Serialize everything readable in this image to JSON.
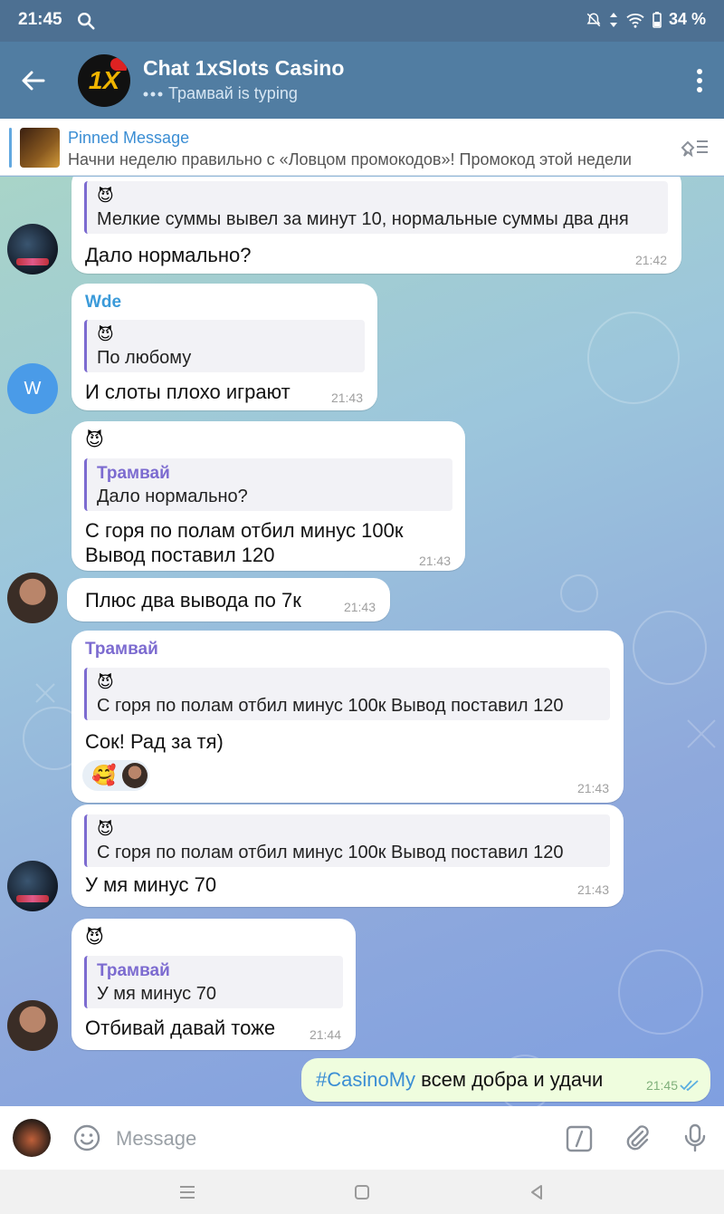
{
  "status": {
    "time": "21:45",
    "battery": "34 %"
  },
  "header": {
    "title": "Chat 1xSlots Casino",
    "subtitle": "Трамвай is typing",
    "avatar_label": "1X"
  },
  "pinned": {
    "title": "Pinned Message",
    "text": "Начни неделю правильно с «Ловцом промокодов»!   Промокод этой недели"
  },
  "messages": [
    {
      "reply_emoji": "😈",
      "reply_text": "Мелкие суммы вывел за минут 10, нормальные суммы два дня",
      "text": "Дало нормально?",
      "time": "21:42"
    },
    {
      "sender": "Wde",
      "reply_emoji": "😈",
      "reply_text": "По любому",
      "text": "И слоты плохо играют",
      "time": "21:43",
      "avatar_letter": "W"
    },
    {
      "sender_emoji": "😈",
      "reply_name": "Трамвай",
      "reply_text": "Дало нормально?",
      "text_line1": "С горя  по полам отбил минус 100к",
      "text_line2": "Вывод поставил 120",
      "time": "21:43"
    },
    {
      "text": "Плюс два вывода по 7к",
      "time": "21:43"
    },
    {
      "sender": "Трамвай",
      "reply_emoji": "😈",
      "reply_text": "С горя  по полам отбил минус 100к Вывод поставил 120",
      "text": "Сок! Рад за тя)",
      "reaction": "🥰",
      "time": "21:43"
    },
    {
      "reply_emoji": "😈",
      "reply_text": "С горя  по полам отбил минус 100к Вывод поставил 120",
      "text": "У мя минус 70",
      "time": "21:43"
    },
    {
      "sender_emoji": "😈",
      "reply_name": "Трамвай",
      "reply_text": "У мя минус 70",
      "text": "Отбивай давай тоже",
      "time": "21:44"
    },
    {
      "hashtag": "#CasinoMy",
      "text": " всем добра и удачи",
      "time": "21:45"
    }
  ],
  "input": {
    "placeholder": "Message"
  },
  "colors": {
    "header": "#517da2",
    "statusbar": "#4d7092",
    "link": "#3b8ed4",
    "reply_accent": "#7c6bd0",
    "outgoing": "#effdde",
    "name_wde": "#3a9ad9"
  },
  "icons": [
    "search-icon",
    "mute-icon",
    "wifi-icon",
    "battery-icon",
    "back-arrow-icon",
    "more-vert-icon",
    "unpin-icon",
    "emoji-icon",
    "bot-command-icon",
    "attach-icon",
    "mic-icon",
    "read-checks-icon"
  ]
}
